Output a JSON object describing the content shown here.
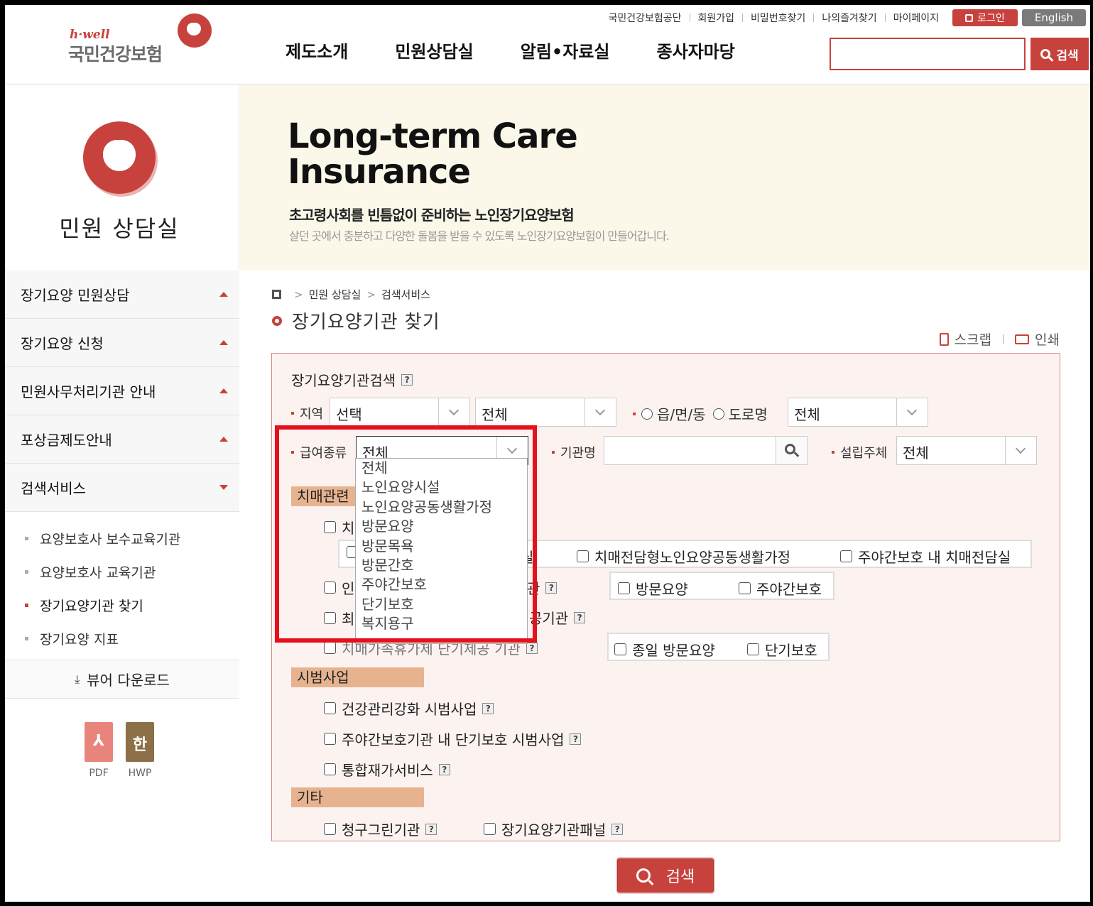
{
  "header": {
    "logo_tagline": "h·well",
    "logo_name": "국민건강보험",
    "utility": [
      "국민건강보험공단",
      "회원가입",
      "비밀번호찾기",
      "나의즐겨찾기",
      "마이페이지"
    ],
    "login_label": "로그인",
    "english_label": "English",
    "gnb": [
      "제도소개",
      "민원상담실",
      "알림•자료실",
      "종사자마당"
    ],
    "search_value": "",
    "search_button": "검색",
    "accent_color": "#c8423d"
  },
  "side": {
    "title": "민원 상담실",
    "menu": [
      {
        "label": "장기요양 민원상담"
      },
      {
        "label": "장기요양 신청"
      },
      {
        "label": "민원사무처리기관 안내"
      },
      {
        "label": "포상금제도안내"
      },
      {
        "label": "검색서비스"
      }
    ],
    "submenu": [
      "요양보호사 보수교육기관",
      "요양보호사 교육기관",
      "장기요양기관 찾기",
      "장기요양 지표"
    ],
    "viewer_download": "뷰어 다운로드",
    "docs": [
      {
        "label": "PDF",
        "glyph": "⅄"
      },
      {
        "label": "HWP",
        "glyph": "한"
      }
    ]
  },
  "hero": {
    "title_line1": "Long-term Care",
    "title_line2": "Insurance",
    "subtitle": "초고령사회를 빈틈없이 준비하는 노인장기요양보험",
    "desc": "살던 곳에서 충분하고 다양한 돌봄을 받을 수 있도록 노인장기요양보험이 만들어갑니다."
  },
  "content": {
    "breadcrumb": [
      "민원 상담실",
      "검색서비스"
    ],
    "page_title": "장기요양기관 찾기",
    "tools": {
      "scrap": "스크랩",
      "print": "인쇄"
    },
    "box_title": "장기요양기관검색",
    "help": "?",
    "region": {
      "label": "지역",
      "sido": "선택",
      "sigungu": "전체"
    },
    "addr_radios": [
      "읍/면/동",
      "도로명"
    ],
    "addr_select": "전체",
    "benefit": {
      "label": "급여종류",
      "value": "전체"
    },
    "inst_name": {
      "label": "기관명",
      "value": ""
    },
    "founder": {
      "label": "설립주체",
      "value": "전체"
    },
    "dropdown_options": [
      "전체",
      "노인요양시설",
      "노인요양공동생활가정",
      "방문요양",
      "방문목욕",
      "방문간호",
      "주야간보호",
      "단기보호",
      "복지용구"
    ],
    "dementia": {
      "label": "치매관련",
      "row1_prefix": "치",
      "row1_sub": [
        "실",
        "치매전담형노인요양공동생활가정",
        "주야간보호 내 치매전담실"
      ],
      "row2_prefix": "인",
      "row2_suffix": "관",
      "row2_sub": [
        "방문요양",
        "주야간보호"
      ],
      "row3_prefix": "최",
      "row3_suffix": "공기관",
      "row4_text": "치매가족휴가제 단기제공 기관",
      "row4_sub": [
        "종일 방문요양",
        "단기보호"
      ]
    },
    "pilot": {
      "label": "시범사업",
      "items": [
        "건강관리강화 시범사업",
        "주야간보호기관 내 단기보호 시범사업",
        "통합재가서비스"
      ]
    },
    "etc": {
      "label": "기타",
      "items": [
        "청구그린기관",
        "장기요양기관패널"
      ]
    },
    "search_button": "검색"
  }
}
